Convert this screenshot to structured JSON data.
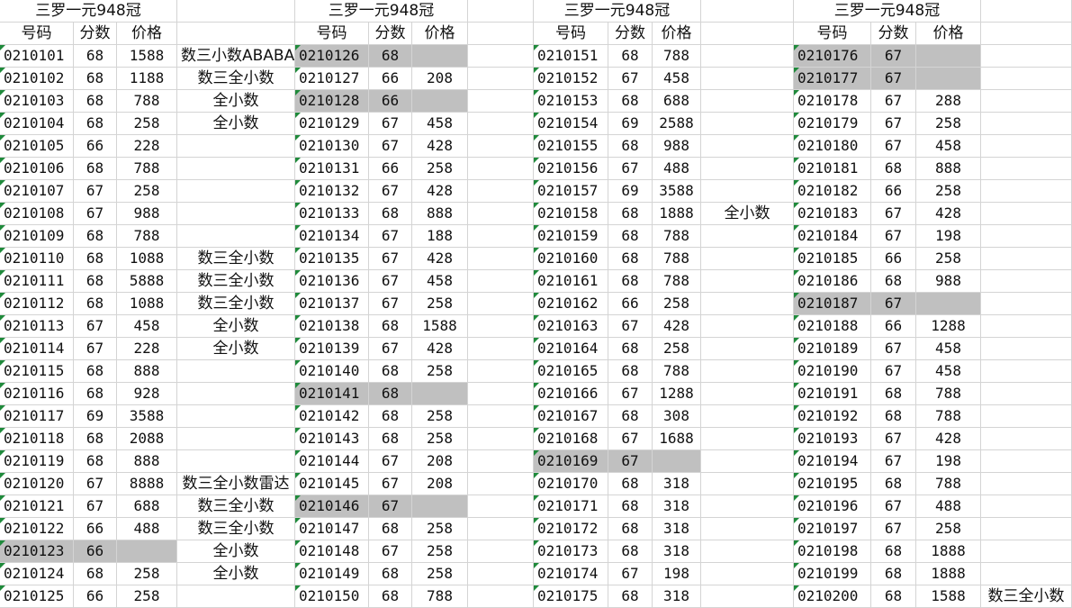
{
  "title": "三罗一元948冠",
  "headers": [
    "号码",
    "分数",
    "价格"
  ],
  "notes": [
    "数三小数ABABA",
    "数三全小数",
    "全小数",
    "全小数",
    "",
    "",
    "",
    "",
    "",
    "数三全小数",
    "数三全小数",
    "数三全小数",
    "全小数",
    "全小数",
    "",
    "",
    "",
    "",
    "",
    "数三全小数雷达",
    "数三全小数",
    "数三全小数",
    "全小数",
    "全小数",
    ""
  ],
  "note_col3_row8": "全小数",
  "note_col4_last": "数三全小数",
  "blocks": [
    {
      "rows": [
        [
          "0210101",
          "68",
          "1588"
        ],
        [
          "0210102",
          "68",
          "1188"
        ],
        [
          "0210103",
          "68",
          "788"
        ],
        [
          "0210104",
          "68",
          "258"
        ],
        [
          "0210105",
          "66",
          "228"
        ],
        [
          "0210106",
          "68",
          "788"
        ],
        [
          "0210107",
          "67",
          "258"
        ],
        [
          "0210108",
          "67",
          "988"
        ],
        [
          "0210109",
          "68",
          "788"
        ],
        [
          "0210110",
          "68",
          "1088"
        ],
        [
          "0210111",
          "68",
          "5888"
        ],
        [
          "0210112",
          "68",
          "1088"
        ],
        [
          "0210113",
          "67",
          "458"
        ],
        [
          "0210114",
          "67",
          "228"
        ],
        [
          "0210115",
          "68",
          "888"
        ],
        [
          "0210116",
          "68",
          "928"
        ],
        [
          "0210117",
          "69",
          "3588"
        ],
        [
          "0210118",
          "68",
          "2088"
        ],
        [
          "0210119",
          "68",
          "888"
        ],
        [
          "0210120",
          "67",
          "8888"
        ],
        [
          "0210121",
          "67",
          "688"
        ],
        [
          "0210122",
          "66",
          "488"
        ],
        [
          "0210123",
          "66",
          ""
        ],
        [
          "0210124",
          "68",
          "258"
        ],
        [
          "0210125",
          "66",
          "258"
        ]
      ],
      "highlighted": [
        22
      ]
    },
    {
      "rows": [
        [
          "0210126",
          "68",
          ""
        ],
        [
          "0210127",
          "66",
          "208"
        ],
        [
          "0210128",
          "66",
          ""
        ],
        [
          "0210129",
          "67",
          "458"
        ],
        [
          "0210130",
          "67",
          "428"
        ],
        [
          "0210131",
          "66",
          "258"
        ],
        [
          "0210132",
          "67",
          "428"
        ],
        [
          "0210133",
          "68",
          "888"
        ],
        [
          "0210134",
          "67",
          "188"
        ],
        [
          "0210135",
          "67",
          "428"
        ],
        [
          "0210136",
          "67",
          "458"
        ],
        [
          "0210137",
          "67",
          "258"
        ],
        [
          "0210138",
          "68",
          "1588"
        ],
        [
          "0210139",
          "67",
          "428"
        ],
        [
          "0210140",
          "68",
          "258"
        ],
        [
          "0210141",
          "68",
          ""
        ],
        [
          "0210142",
          "68",
          "258"
        ],
        [
          "0210143",
          "68",
          "258"
        ],
        [
          "0210144",
          "67",
          "208"
        ],
        [
          "0210145",
          "67",
          "208"
        ],
        [
          "0210146",
          "67",
          ""
        ],
        [
          "0210147",
          "68",
          "258"
        ],
        [
          "0210148",
          "67",
          "258"
        ],
        [
          "0210149",
          "68",
          "258"
        ],
        [
          "0210150",
          "68",
          "788"
        ]
      ],
      "highlighted": [
        0,
        2,
        15,
        20
      ]
    },
    {
      "rows": [
        [
          "0210151",
          "68",
          "788"
        ],
        [
          "0210152",
          "67",
          "458"
        ],
        [
          "0210153",
          "68",
          "688"
        ],
        [
          "0210154",
          "69",
          "2588"
        ],
        [
          "0210155",
          "68",
          "988"
        ],
        [
          "0210156",
          "67",
          "488"
        ],
        [
          "0210157",
          "69",
          "3588"
        ],
        [
          "0210158",
          "68",
          "1888"
        ],
        [
          "0210159",
          "68",
          "788"
        ],
        [
          "0210160",
          "68",
          "788"
        ],
        [
          "0210161",
          "68",
          "788"
        ],
        [
          "0210162",
          "66",
          "258"
        ],
        [
          "0210163",
          "67",
          "428"
        ],
        [
          "0210164",
          "68",
          "258"
        ],
        [
          "0210165",
          "68",
          "788"
        ],
        [
          "0210166",
          "67",
          "1288"
        ],
        [
          "0210167",
          "68",
          "308"
        ],
        [
          "0210168",
          "67",
          "1688"
        ],
        [
          "0210169",
          "67",
          ""
        ],
        [
          "0210170",
          "68",
          "318"
        ],
        [
          "0210171",
          "68",
          "318"
        ],
        [
          "0210172",
          "68",
          "318"
        ],
        [
          "0210173",
          "68",
          "318"
        ],
        [
          "0210174",
          "67",
          "198"
        ],
        [
          "0210175",
          "68",
          "318"
        ]
      ],
      "highlighted": [
        18
      ]
    },
    {
      "rows": [
        [
          "0210176",
          "67",
          ""
        ],
        [
          "0210177",
          "67",
          ""
        ],
        [
          "0210178",
          "67",
          "288"
        ],
        [
          "0210179",
          "67",
          "258"
        ],
        [
          "0210180",
          "67",
          "458"
        ],
        [
          "0210181",
          "68",
          "888"
        ],
        [
          "0210182",
          "66",
          "258"
        ],
        [
          "0210183",
          "67",
          "428"
        ],
        [
          "0210184",
          "67",
          "198"
        ],
        [
          "0210185",
          "66",
          "258"
        ],
        [
          "0210186",
          "68",
          "988"
        ],
        [
          "0210187",
          "67",
          ""
        ],
        [
          "0210188",
          "66",
          "1288"
        ],
        [
          "0210189",
          "67",
          "458"
        ],
        [
          "0210190",
          "67",
          "458"
        ],
        [
          "0210191",
          "68",
          "788"
        ],
        [
          "0210192",
          "68",
          "788"
        ],
        [
          "0210193",
          "67",
          "428"
        ],
        [
          "0210194",
          "67",
          "198"
        ],
        [
          "0210195",
          "68",
          "788"
        ],
        [
          "0210196",
          "67",
          "488"
        ],
        [
          "0210197",
          "67",
          "258"
        ],
        [
          "0210198",
          "68",
          "1888"
        ],
        [
          "0210199",
          "68",
          "1888"
        ],
        [
          "0210200",
          "68",
          "1588"
        ]
      ],
      "highlighted": [
        0,
        1,
        11
      ]
    }
  ]
}
